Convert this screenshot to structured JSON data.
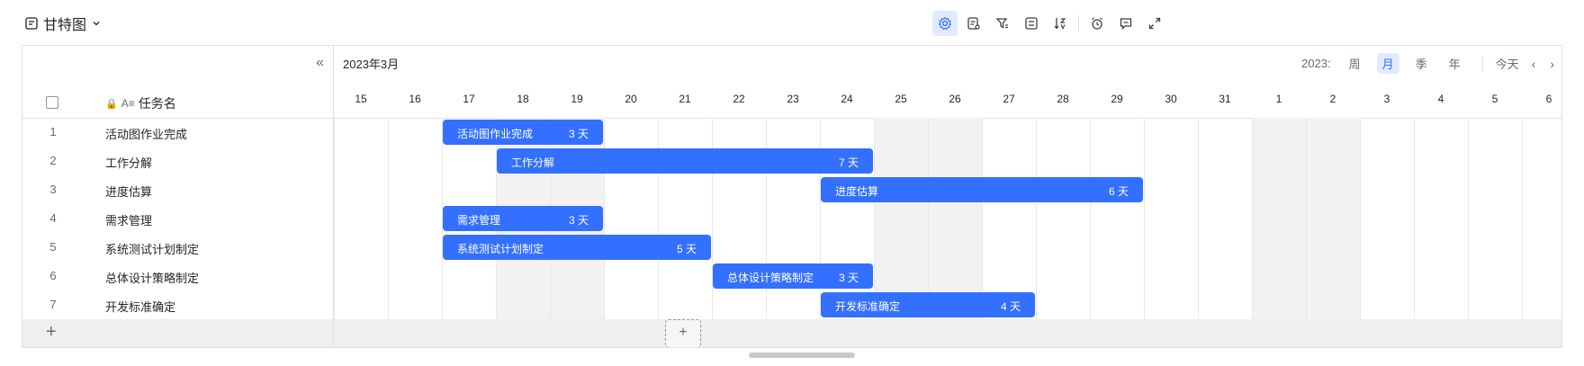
{
  "toolbar": {
    "view_name": "甘特图",
    "icons": [
      "gantt-settings-icon",
      "field-settings-icon",
      "filter-icon",
      "group-icon",
      "sort-icon",
      "reminder-icon",
      "comment-icon",
      "expand-icon"
    ]
  },
  "left_panel": {
    "column_title": "任务名",
    "tasks": [
      {
        "idx": "1",
        "name": "活动图作业完成"
      },
      {
        "idx": "2",
        "name": "工作分解"
      },
      {
        "idx": "3",
        "name": "进度估算"
      },
      {
        "idx": "4",
        "name": "需求管理"
      },
      {
        "idx": "5",
        "name": "系统测试计划制定"
      },
      {
        "idx": "6",
        "name": "总体设计策略制定"
      },
      {
        "idx": "7",
        "name": "开发标准确定"
      }
    ]
  },
  "timeline": {
    "month_label": "2023年3月",
    "year_label": "2023:",
    "scale_options": [
      "周",
      "月",
      "季",
      "年"
    ],
    "active_scale": "月",
    "today_label": "今天",
    "days": [
      "15",
      "16",
      "17",
      "18",
      "19",
      "20",
      "21",
      "22",
      "23",
      "24",
      "25",
      "26",
      "27",
      "28",
      "29",
      "30",
      "31",
      "1",
      "2",
      "3",
      "4",
      "5",
      "6"
    ],
    "weekend_days": [
      "18",
      "19",
      "25",
      "26",
      "1",
      "2"
    ],
    "bars": [
      {
        "label": "活动图作业完成",
        "duration_label": "3 天",
        "start_day": "17",
        "days": 3
      },
      {
        "label": "工作分解",
        "duration_label": "7 天",
        "start_day": "18",
        "days": 7
      },
      {
        "label": "进度估算",
        "duration_label": "6 天",
        "start_day": "24",
        "days": 6
      },
      {
        "label": "需求管理",
        "duration_label": "3 天",
        "start_day": "17",
        "days": 3
      },
      {
        "label": "系统测试计划制定",
        "duration_label": "5 天",
        "start_day": "17",
        "days": 5
      },
      {
        "label": "总体设计策略制定",
        "duration_label": "3 天",
        "start_day": "22",
        "days": 3
      },
      {
        "label": "开发标准确定",
        "duration_label": "4 天",
        "start_day": "24",
        "days": 4
      }
    ]
  },
  "colors": {
    "accent": "#3370ff",
    "weekend": "#f2f2f2",
    "border": "#dee0e3"
  }
}
